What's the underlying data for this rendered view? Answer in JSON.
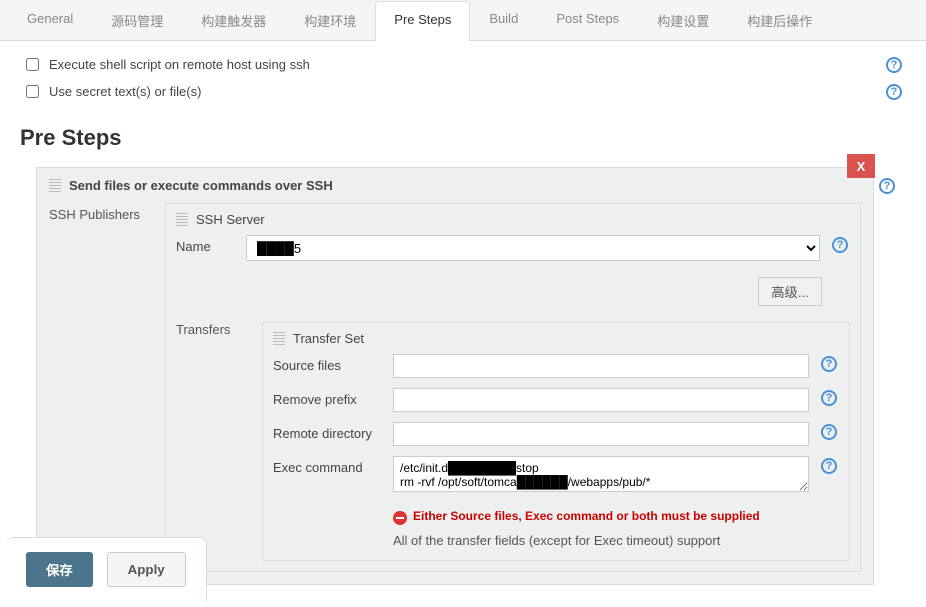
{
  "tabs": [
    {
      "label": "General"
    },
    {
      "label": "源码管理"
    },
    {
      "label": "构建触发器"
    },
    {
      "label": "构建环境"
    },
    {
      "label": "Pre Steps"
    },
    {
      "label": "Build"
    },
    {
      "label": "Post Steps"
    },
    {
      "label": "构建设置"
    },
    {
      "label": "构建后操作"
    }
  ],
  "active_tab": "Pre Steps",
  "options": {
    "opt1": "Execute shell script on remote host using ssh",
    "opt2": "Use secret text(s) or file(s)"
  },
  "section_heading": "Pre Steps",
  "ssh_block": {
    "title": "Send files or execute commands over SSH",
    "close": "X",
    "publishers_label": "SSH Publishers",
    "server_label": "SSH Server",
    "name_label": "Name",
    "name_value": "████5",
    "advanced_btn": "高级...",
    "transfers_label": "Transfers",
    "transfer_set_label": "Transfer Set",
    "fields": {
      "source_files": {
        "label": "Source files",
        "value": ""
      },
      "remove_prefix": {
        "label": "Remove prefix",
        "value": ""
      },
      "remote_dir": {
        "label": "Remote directory",
        "value": ""
      },
      "exec_cmd": {
        "label": "Exec command",
        "value": "/etc/init.d████████stop\nrm -rvf /opt/soft/tomca██████/webapps/pub/*"
      }
    },
    "error_msg": "Either Source files, Exec command or both must be supplied",
    "note": "All of the transfer fields (except for Exec timeout) support"
  },
  "footer": {
    "save": "保存",
    "apply": "Apply"
  },
  "help_glyph": "?"
}
